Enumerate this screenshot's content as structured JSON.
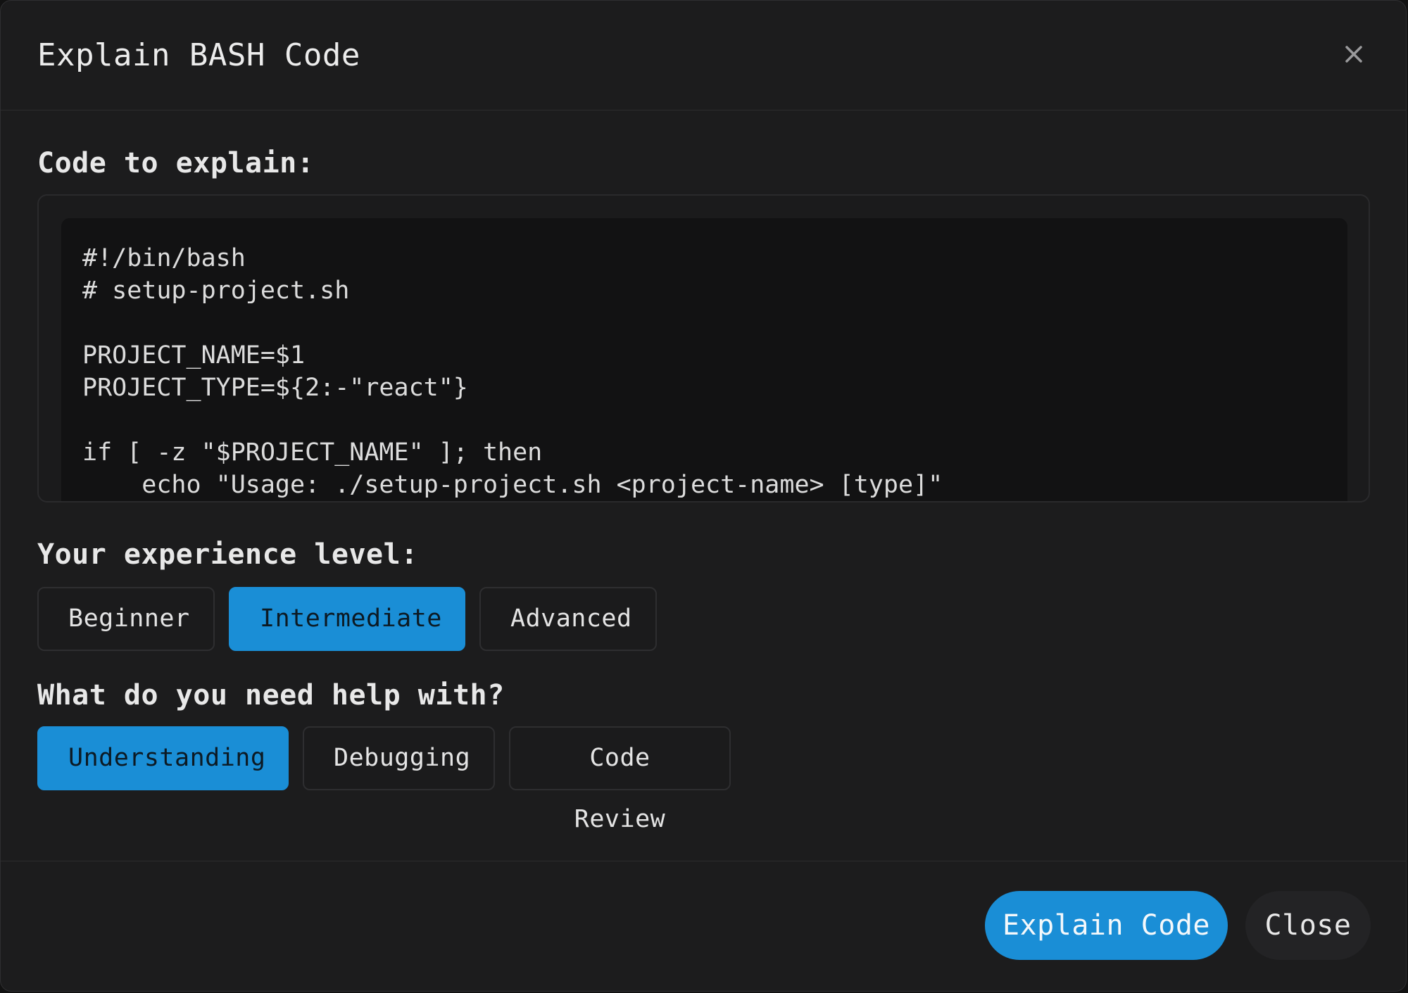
{
  "dialog": {
    "title": "Explain BASH Code",
    "close_icon": "close-icon"
  },
  "code_section": {
    "label": "Code to explain:",
    "lines": [
      "#!/bin/bash",
      "# setup-project.sh",
      "",
      "PROJECT_NAME=$1",
      "PROJECT_TYPE=${2:-\"react\"}",
      "",
      "if [ -z \"$PROJECT_NAME\" ]; then",
      "    echo \"Usage: ./setup-project.sh <project-name> [type]\""
    ]
  },
  "experience": {
    "label": "Your experience level:",
    "options": [
      "Beginner",
      "Intermediate",
      "Advanced"
    ],
    "selected": "Intermediate"
  },
  "help": {
    "label": "What do you need help with?",
    "options": [
      "Understanding",
      "Debugging",
      "Code Review"
    ],
    "selected": "Understanding"
  },
  "footer": {
    "explain_label": "Explain Code",
    "close_label": "Close"
  },
  "colors": {
    "accent": "#1a8ed6",
    "background": "#1c1c1d",
    "code_background": "#121213"
  }
}
